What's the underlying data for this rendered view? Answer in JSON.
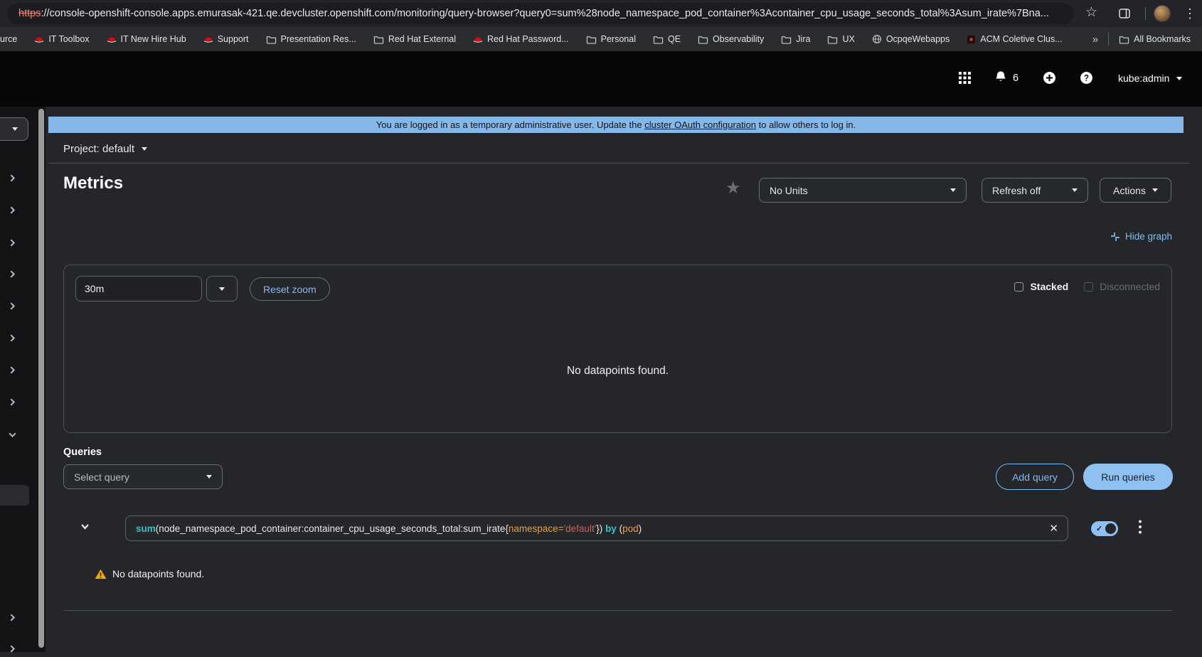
{
  "browser": {
    "url": {
      "scheme": "https",
      "rest": "://console-openshift-console.apps.emurasak-421.qe.devcluster.openshift.com/monitoring/query-browser?query0=sum%28node_namespace_pod_container%3Acontainer_cpu_usage_seconds_total%3Asum_irate%7Bna..."
    },
    "bookmarks": [
      {
        "label": "urce"
      },
      {
        "label": "IT Toolbox"
      },
      {
        "label": "IT New Hire Hub"
      },
      {
        "label": "Support"
      },
      {
        "label": "Presentation Res..."
      },
      {
        "label": "Red Hat External"
      },
      {
        "label": "Red Hat Password..."
      },
      {
        "label": "Personal"
      },
      {
        "label": "QE"
      },
      {
        "label": "Observability"
      },
      {
        "label": "Jira"
      },
      {
        "label": "UX"
      },
      {
        "label": "OcpqeWebapps"
      },
      {
        "label": "ACM Coletive Clus..."
      }
    ],
    "overflow_chevron": "»",
    "all_bookmarks": "All Bookmarks"
  },
  "masthead": {
    "notification_count": "6",
    "username": "kube:admin"
  },
  "banner": {
    "before": "You are logged in as a temporary administrative user. Update the ",
    "link": "cluster OAuth configuration",
    "after": " to allow others to log in."
  },
  "project_bar": {
    "label": "Project: default"
  },
  "page": {
    "title": "Metrics",
    "units_select": "No Units",
    "refresh_select": "Refresh off",
    "actions_button": "Actions",
    "hide_graph": "Hide graph"
  },
  "graph_panel": {
    "timespan": "30m",
    "reset_zoom": "Reset zoom",
    "stacked_label": "Stacked",
    "disconnected_label": "Disconnected",
    "empty_message": "No datapoints found."
  },
  "queries": {
    "heading": "Queries",
    "select_placeholder": "Select query",
    "add_button": "Add query",
    "run_button": "Run queries",
    "no_data": "No datapoints found.",
    "expr": [
      {
        "t": "sum"
      },
      {
        "t": "("
      },
      {
        "t": "node_namespace_pod_container:container_cpu_usage_seconds_total:sum_irate"
      },
      {
        "t": "{"
      },
      {
        "t": "namespace"
      },
      {
        "t": "="
      },
      {
        "t": "'default'"
      },
      {
        "t": "}"
      },
      {
        "t": ")"
      },
      {
        "t": " "
      },
      {
        "t": "by"
      },
      {
        "t": " ("
      },
      {
        "t": "pod"
      },
      {
        "t": ")"
      }
    ]
  },
  "colors": {
    "accent_link": "#86b9ef",
    "run_button_bg": "#8fc0f2",
    "banner_bg": "#85b7e8",
    "warning": "#f0ab00",
    "token_function": "#3dc0c5",
    "token_label": "#eaa038",
    "token_string": "#d16055"
  }
}
